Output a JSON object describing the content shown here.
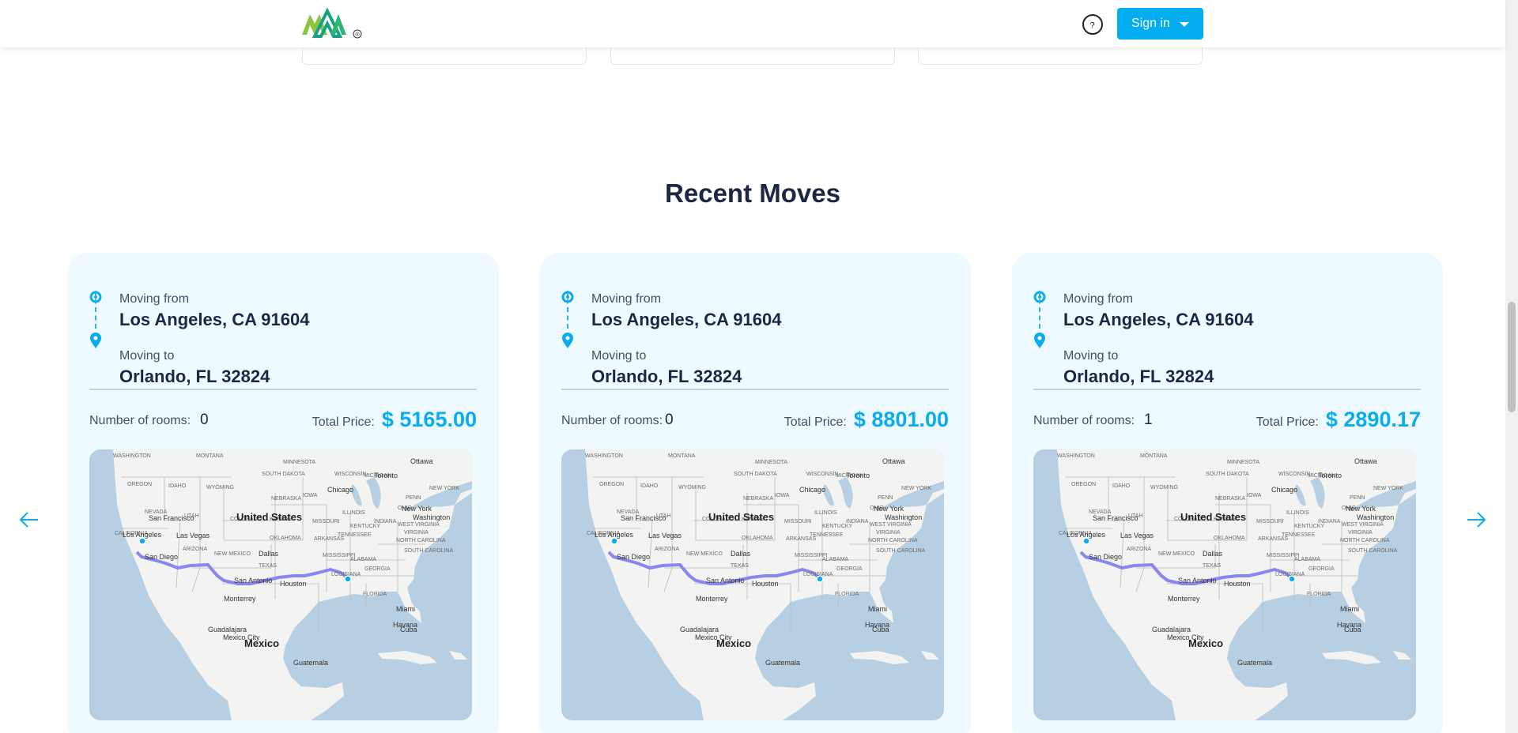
{
  "header": {
    "signin_label": "Sign in",
    "help_glyph": "?",
    "logo_mark": "®"
  },
  "section_title": "Recent Moves",
  "labels": {
    "moving_from": "Moving from",
    "moving_to": "Moving to",
    "rooms": "Number of rooms:",
    "total_price": "Total Price:"
  },
  "moves": [
    {
      "from": "Los Angeles, CA 91604",
      "to": "Orlando, FL 32824",
      "rooms": "0",
      "price": "$ 5165.00"
    },
    {
      "from": "Los Angeles, CA 91604",
      "to": "Orlando, FL 32824",
      "rooms": "0",
      "price": "$ 8801.00"
    },
    {
      "from": "Los Angeles, CA 91604",
      "to": "Orlando, FL 32824",
      "rooms": "1",
      "price": "$ 2890.17"
    }
  ],
  "map_labels": {
    "country": "United States",
    "mexico": "Mexico",
    "cities": [
      "Los Angeles",
      "San Diego",
      "San Francisco",
      "Las Vegas",
      "Dallas",
      "Houston",
      "San Antonio",
      "Chicago",
      "Toronto",
      "New York",
      "Washington",
      "Ottawa",
      "Miami",
      "Havana",
      "Cuba",
      "Monterrey",
      "Guadalajara",
      "Mexico City",
      "Guatemala"
    ],
    "states": [
      "WASHINGTON",
      "MONTANA",
      "MINNESOTA",
      "OREGON",
      "IDAHO",
      "WYOMING",
      "SOUTH DAKOTA",
      "WISCONSIN",
      "MICHIGAN",
      "NEBRASKA",
      "IOWA",
      "NEVADA",
      "UTAH",
      "COLORADO",
      "KANSAS",
      "MISSOURI",
      "ILLINOIS",
      "INDIANA",
      "OHIO",
      "PENN",
      "NEW YORK",
      "CALIFORNIA",
      "ARIZONA",
      "NEW MEXICO",
      "OKLAHOMA",
      "ARKANSAS",
      "TENNESSEE",
      "KENTUCKY",
      "WEST VIRGINIA",
      "VIRGINIA",
      "NORTH CAROLINA",
      "SOUTH CAROLINA",
      "TEXAS",
      "LOUISIANA",
      "MISSISSIPPI",
      "ALABAMA",
      "GEORGIA",
      "FLORIDA"
    ]
  },
  "colors": {
    "accent": "#04acf0",
    "card_bg": "#eefaff",
    "route": "#8a86f0"
  }
}
